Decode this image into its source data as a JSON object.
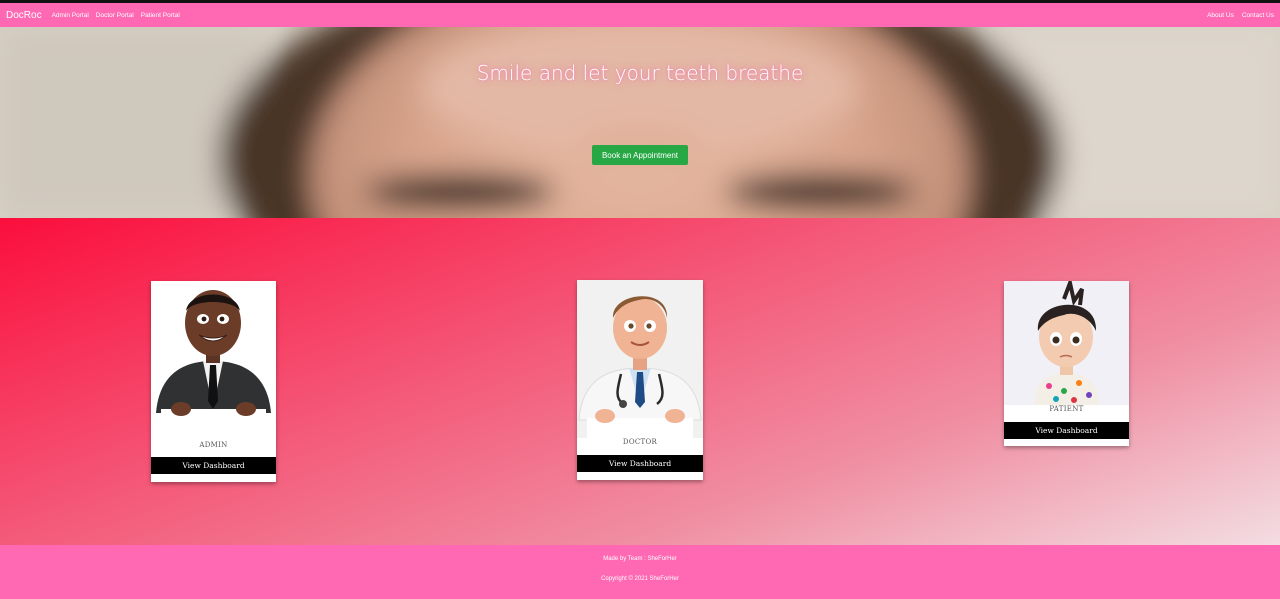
{
  "navbar": {
    "brand": "DocRoc",
    "left_links": [
      "Admin Portal",
      "Doctor Portal",
      "Patient Portal"
    ],
    "right_links": [
      "About Us",
      "Contact Us"
    ],
    "color": "#ff69b4"
  },
  "hero": {
    "title": "Smile and let your teeth breathe",
    "button_label": "Book an Appointment",
    "button_color": "#28a745"
  },
  "cards": [
    {
      "label": "ADMIN",
      "button": "View Dashboard"
    },
    {
      "label": "DOCTOR",
      "button": "View Dashboard"
    },
    {
      "label": "PATIENT",
      "button": "View Dashboard"
    }
  ],
  "footer": {
    "made_by": "Made by Team : SheForHer",
    "copyright": "Copyright © 2021 SheForHer"
  }
}
